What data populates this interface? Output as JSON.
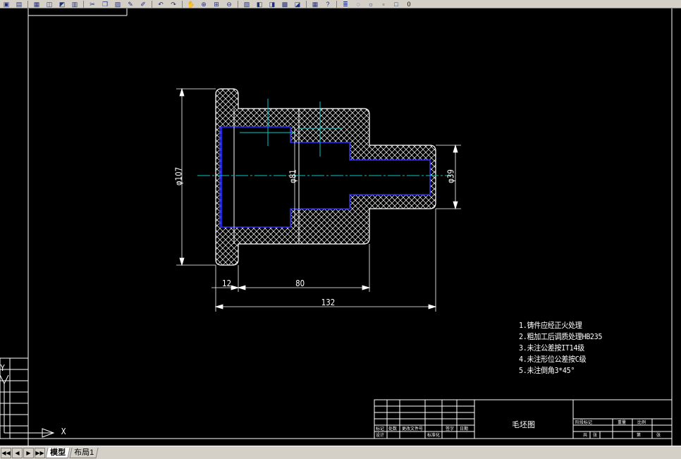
{
  "toolbar": {
    "icons": [
      "open-icon",
      "save-icon",
      "print-icon",
      "preview-icon",
      "publish-icon",
      "plot-icon",
      "cut-icon",
      "copy-icon",
      "paste-icon",
      "matchprop-icon",
      "brush-icon",
      "undo-icon",
      "redo-icon",
      "pan-icon",
      "zoom-realtime-icon",
      "zoom-window-icon",
      "zoom-previous-icon",
      "properties-icon",
      "designcenter-icon",
      "toolpalette-icon",
      "sheetset-icon",
      "markup-icon",
      "calc-icon",
      "help-icon",
      "layers-icon",
      "bulb-icon",
      "sun-icon",
      "lock-icon",
      "color-square-icon"
    ],
    "layer_value": "0"
  },
  "drawing": {
    "dimensions": {
      "dia_left": "φ107",
      "dia_middle": "φ81",
      "dia_right": "φ39",
      "len_12": "12",
      "len_80": "80",
      "len_132": "132"
    },
    "notes": [
      "1.铸件应经正火处理",
      "2.粗加工后调质处理HB235",
      "3.未注公差按IT14级",
      "4.未注形位公差按C级",
      "5.未注倒角3*45°"
    ]
  },
  "title_block": {
    "drawing_name": "毛坯图",
    "left_cells": [
      "标记",
      "处数",
      "更改文件号",
      "签字",
      "日期",
      "设计",
      "标准化"
    ],
    "right_cells": [
      "阶段标记",
      "重量",
      "比例",
      "共",
      "张",
      "第",
      "张"
    ]
  },
  "ucs": {
    "y_label": "Y",
    "x_label": "X"
  },
  "tabs": {
    "nav": [
      "◀◀",
      "◀",
      "▶",
      "▶▶"
    ],
    "model": "模型",
    "layout1": "布局1"
  }
}
